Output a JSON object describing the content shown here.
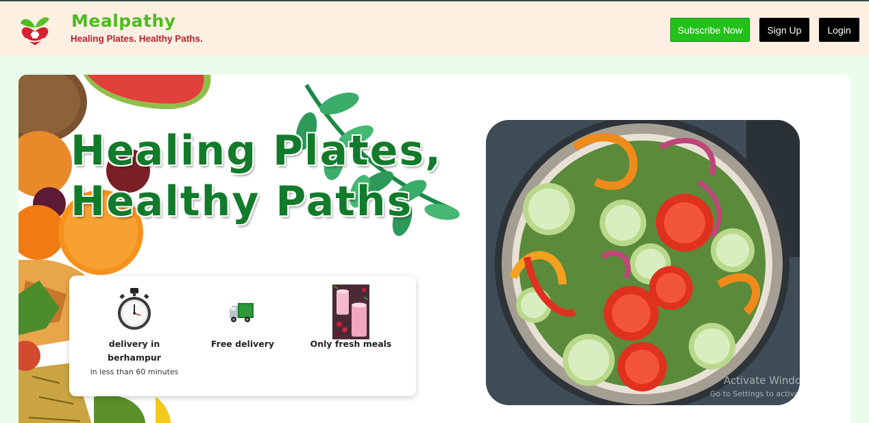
{
  "header": {
    "brand_name": "Mealpathy",
    "tagline": "Healing Plates. Healthy Paths.",
    "buttons": {
      "subscribe": "Subscribe Now",
      "signup": "Sign Up",
      "login": "Login"
    }
  },
  "hero": {
    "title_line1": "Healing Plates,",
    "title_line2": "Healthy Paths",
    "features": [
      {
        "label": "delivery in berhampur",
        "sublabel": "in less than 60 minutes",
        "icon": "stopwatch-icon"
      },
      {
        "label": "Free delivery",
        "icon": "delivery-truck-icon"
      },
      {
        "label": "Only fresh meals",
        "icon": "smoothie-photo"
      }
    ]
  },
  "os_overlay": {
    "line1": "Activate Windows",
    "line2": "Go to Settings to activate Windows."
  },
  "colors": {
    "header_bg": "#fdf0e3",
    "page_bg": "#eafdec",
    "brand_green": "#4cbb1e",
    "tagline_red": "#b7202a",
    "title_green": "#127b2b",
    "subscribe_green": "#22c21a"
  }
}
